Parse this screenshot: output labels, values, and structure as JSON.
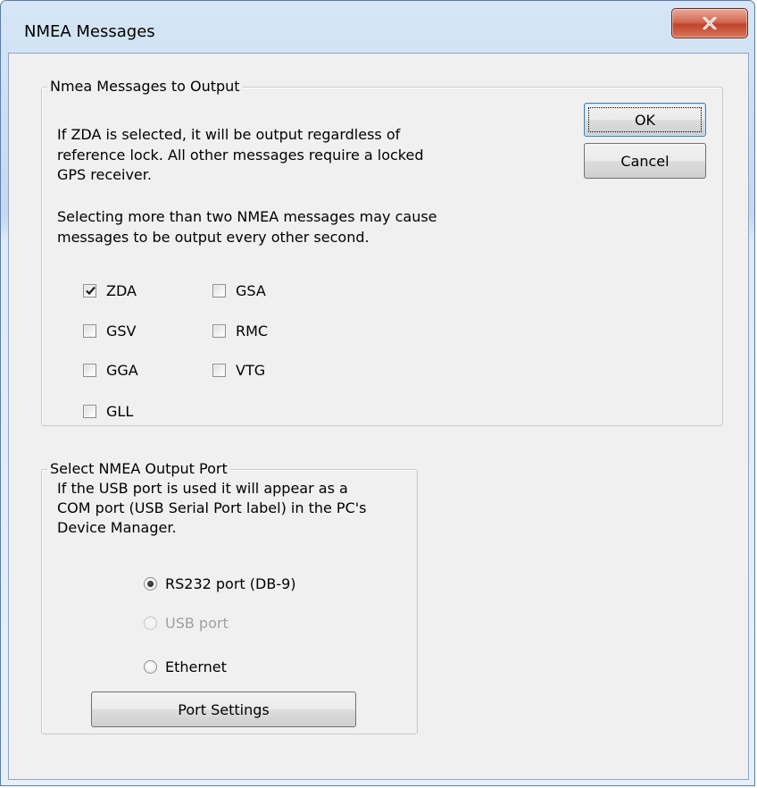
{
  "window": {
    "title": "NMEA Messages",
    "close_icon": "close-icon"
  },
  "messages_group": {
    "legend": "Nmea Messages to Output",
    "description1": [
      "If ZDA is selected, it will be output regardless of",
      "reference lock. All other messages require a locked",
      "GPS receiver."
    ],
    "description2": [
      "Selecting more than two NMEA messages may cause",
      "messages to be output every other second."
    ],
    "checkboxes": [
      {
        "label": "ZDA",
        "checked": true
      },
      {
        "label": "GSA",
        "checked": false
      },
      {
        "label": "GSV",
        "checked": false
      },
      {
        "label": "RMC",
        "checked": false
      },
      {
        "label": "GGA",
        "checked": false
      },
      {
        "label": "VTG",
        "checked": false
      },
      {
        "label": "GLL",
        "checked": false
      }
    ]
  },
  "buttons": {
    "ok": "OK",
    "cancel": "Cancel",
    "port_settings": "Port Settings"
  },
  "port_group": {
    "legend": "Select NMEA Output Port",
    "description": [
      "If the USB port is used it will appear as a",
      "COM port (USB Serial Port label) in the PC's",
      "Device Manager."
    ],
    "radios": [
      {
        "label": "RS232 port (DB-9)",
        "selected": true,
        "enabled": true
      },
      {
        "label": "USB port",
        "selected": false,
        "enabled": false
      },
      {
        "label": "Ethernet",
        "selected": false,
        "enabled": true
      }
    ]
  }
}
